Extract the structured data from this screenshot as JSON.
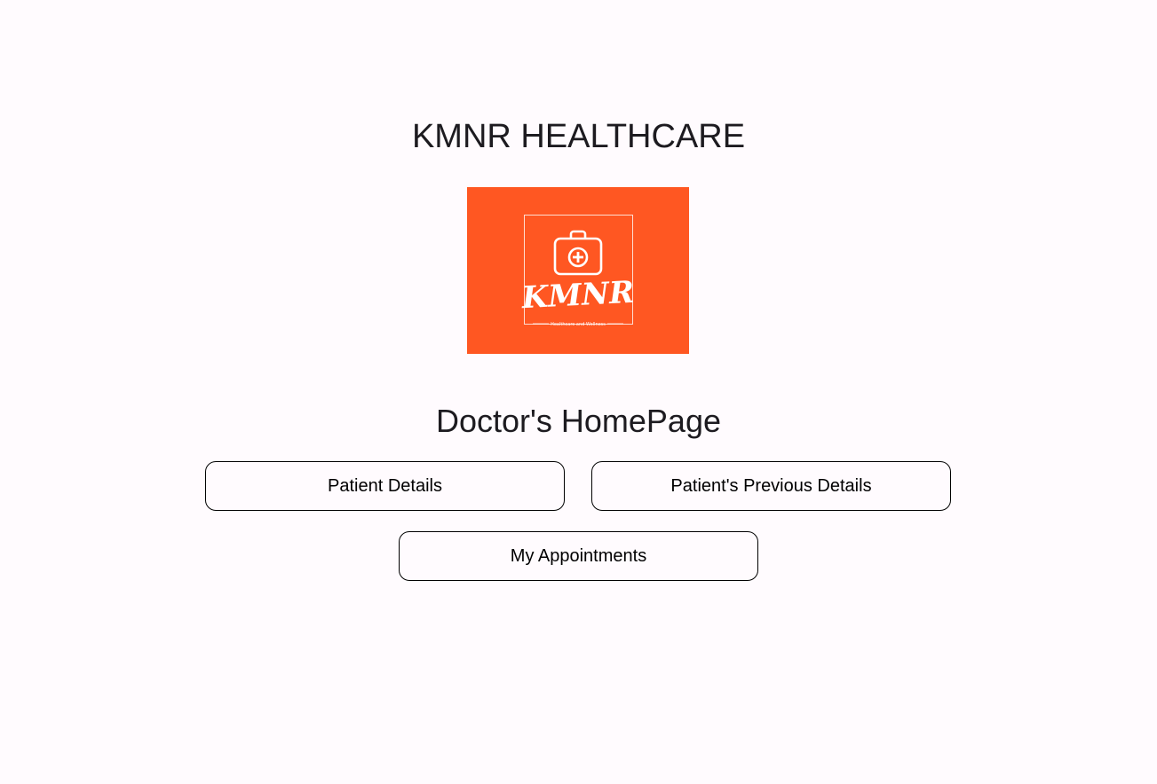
{
  "header": {
    "app_title": "KMNR HEALTHCARE"
  },
  "logo": {
    "brand_text": "KMNR",
    "tagline": "Healthcare and Wellness",
    "background_color": "#ff5722",
    "foreground_color": "#ffffff",
    "icon": "medical-kit-icon"
  },
  "main": {
    "heading": "Doctor's HomePage",
    "buttons": {
      "patient_details": "Patient Details",
      "previous_details": "Patient's Previous Details",
      "appointments": "My Appointments"
    }
  },
  "colors": {
    "background": "#fffbfe",
    "text": "#1d1b20",
    "button_border": "#000000"
  }
}
